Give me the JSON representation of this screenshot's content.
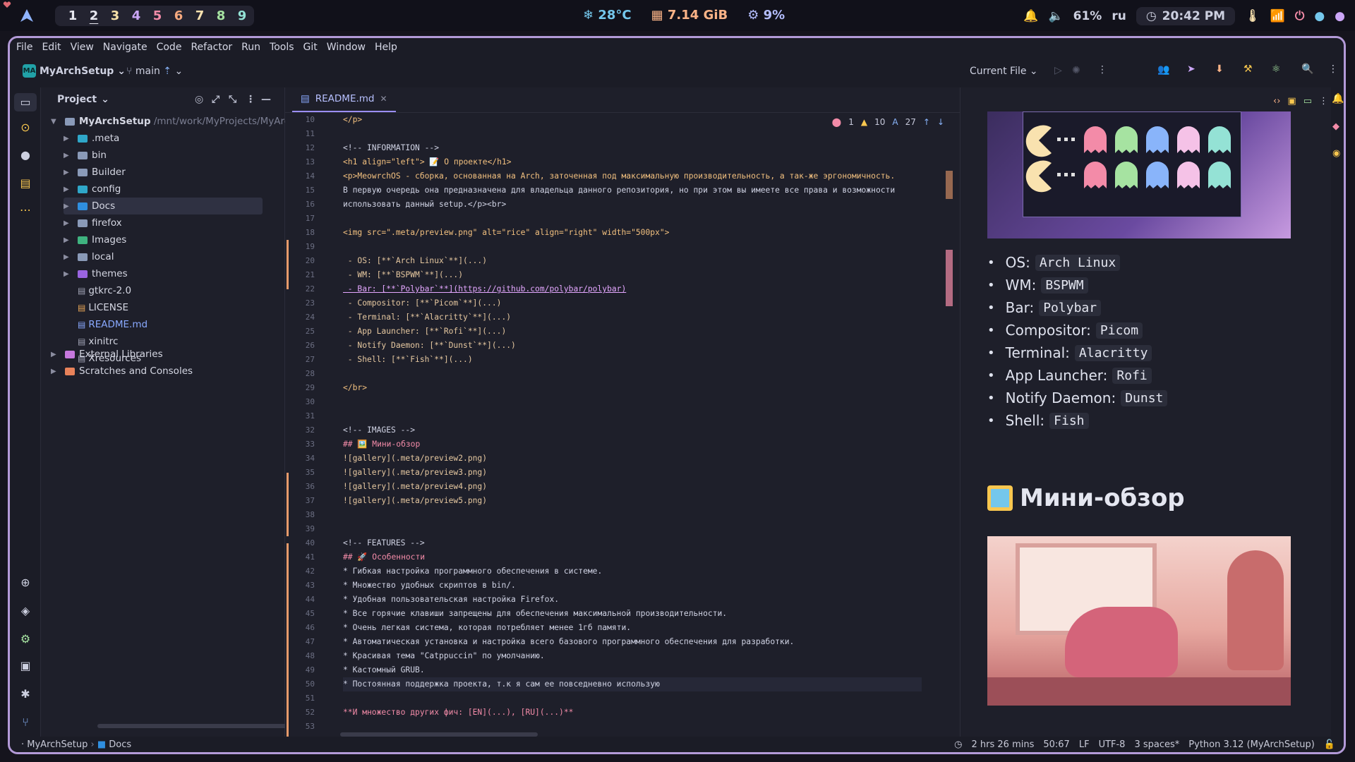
{
  "desktop": {
    "workspaces": [
      "1",
      "2",
      "3",
      "4",
      "5",
      "6",
      "7",
      "8",
      "9"
    ],
    "active_workspace": "2",
    "temperature": "28°C",
    "memory": "7.14 GiB",
    "cpu": "9%",
    "volume": "61%",
    "keyboard_layout": "ru",
    "clock": "20:42 PM"
  },
  "menu": [
    "File",
    "Edit",
    "View",
    "Navigate",
    "Code",
    "Refactor",
    "Run",
    "Tools",
    "Git",
    "Window",
    "Help"
  ],
  "toolbar": {
    "project_badge": "MA",
    "project_name": "MyArchSetup",
    "branch": "main",
    "run_config": "Current File"
  },
  "project_panel": {
    "title": "Project",
    "root_name": "MyArchSetup",
    "root_path": "/mnt/work/MyProjects/MyArchSetup",
    "items": [
      {
        "label": ".meta",
        "type": "folder",
        "color": "#2fa7c9"
      },
      {
        "label": "bin",
        "type": "folder",
        "color": "#8a9ab8"
      },
      {
        "label": "Builder",
        "type": "folder",
        "color": "#8a9ab8"
      },
      {
        "label": "config",
        "type": "folder",
        "color": "#2fa7c9"
      },
      {
        "label": "Docs",
        "type": "folder",
        "color": "#2f8fe0"
      },
      {
        "label": "firefox",
        "type": "folder",
        "color": "#8a9ab8"
      },
      {
        "label": "Images",
        "type": "folder",
        "color": "#3fb380"
      },
      {
        "label": "local",
        "type": "folder",
        "color": "#8a9ab8"
      },
      {
        "label": "themes",
        "type": "folder",
        "color": "#9a64e0"
      },
      {
        "label": "gtkrc-2.0",
        "type": "file",
        "color": "#a0a3b5"
      },
      {
        "label": "LICENSE",
        "type": "file",
        "color": "#e8a657"
      },
      {
        "label": "README.md",
        "type": "file",
        "color": "#89a9ff"
      },
      {
        "label": "xinitrc",
        "type": "file",
        "color": "#a0a3b5"
      },
      {
        "label": "Xresources",
        "type": "file",
        "color": "#a0a3b5"
      }
    ],
    "external": "External Libraries",
    "scratches": "Scratches and Consoles"
  },
  "editor": {
    "tab_label": "README.md",
    "errors": "1",
    "warnings": "10",
    "typos": "27",
    "lines": [
      {
        "n": "10",
        "t": "</p>"
      },
      {
        "n": "11",
        "t": ""
      },
      {
        "n": "12",
        "t": "<!-- INFORMATION -->"
      },
      {
        "n": "13",
        "t": "<h1 align=\"left\"> 📝 О проекте</h1>"
      },
      {
        "n": "14",
        "t": "<p>MeowrchOS - сборка, основанная на Arch, заточенная под максимальную производительность, а так-же эргономичность."
      },
      {
        "n": "15",
        "t": "В первую очередь она предназначена для владельца данного репозитория, но при этом вы имеете все права и возможности"
      },
      {
        "n": "16",
        "t": "использовать данный setup.</p><br>"
      },
      {
        "n": "17",
        "t": ""
      },
      {
        "n": "18",
        "t": "<img src=\".meta/preview.png\" alt=\"rice\" align=\"right\" width=\"500px\">"
      },
      {
        "n": "19",
        "t": ""
      },
      {
        "n": "20",
        "t": " - OS: [**`Arch Linux`**](...)"
      },
      {
        "n": "21",
        "t": " - WM: [**`BSPWM`**](...)"
      },
      {
        "n": "22",
        "t": " - Bar: [**`Polybar`**](https://github.com/polybar/polybar)"
      },
      {
        "n": "23",
        "t": " - Compositor: [**`Picom`**](...)"
      },
      {
        "n": "24",
        "t": " - Terminal: [**`Alacritty`**](...)"
      },
      {
        "n": "25",
        "t": " - App Launcher: [**`Rofi`**](...)"
      },
      {
        "n": "26",
        "t": " - Notify Daemon: [**`Dunst`**](...)"
      },
      {
        "n": "27",
        "t": " - Shell: [**`Fish`**](...)"
      },
      {
        "n": "28",
        "t": ""
      },
      {
        "n": "29",
        "t": "</br>"
      },
      {
        "n": "30",
        "t": ""
      },
      {
        "n": "31",
        "t": ""
      },
      {
        "n": "32",
        "t": "<!-- IMAGES -->"
      },
      {
        "n": "33",
        "t": "## 🖼️ Мини-обзор"
      },
      {
        "n": "34",
        "t": "![gallery](.meta/preview2.png)"
      },
      {
        "n": "35",
        "t": "![gallery](.meta/preview3.png)"
      },
      {
        "n": "36",
        "t": "![gallery](.meta/preview4.png)"
      },
      {
        "n": "37",
        "t": "![gallery](.meta/preview5.png)"
      },
      {
        "n": "38",
        "t": ""
      },
      {
        "n": "39",
        "t": ""
      },
      {
        "n": "40",
        "t": "<!-- FEATURES -->"
      },
      {
        "n": "41",
        "t": "## 🚀 Особенности"
      },
      {
        "n": "42",
        "t": "* Гибкая настройка программного обеспечения в системе."
      },
      {
        "n": "43",
        "t": "* Множество удобных скриптов в bin/."
      },
      {
        "n": "44",
        "t": "* Удобная пользовательская настройка Firefox."
      },
      {
        "n": "45",
        "t": "* Все горячие клавиши запрещены для обеспечения максимальной производительности."
      },
      {
        "n": "46",
        "t": "* Очень легкая система, которая потребляет менее 1гб памяти."
      },
      {
        "n": "47",
        "t": "* Автоматическая установка и настройка всего базового программного обеспечения для разработки."
      },
      {
        "n": "48",
        "t": "* Красивая тема \"Catppuccin\" по умолчанию."
      },
      {
        "n": "49",
        "t": "* Кастомный GRUB."
      },
      {
        "n": "50",
        "t": "* Постоянная поддержка проекта, т.к я сам ее повседневно использую"
      },
      {
        "n": "51",
        "t": ""
      },
      {
        "n": "52",
        "t": "**И множество других фич: [EN](...), [RU](...)**"
      },
      {
        "n": "53",
        "t": ""
      }
    ]
  },
  "preview": {
    "specs": [
      {
        "key": "OS:",
        "value": "Arch Linux"
      },
      {
        "key": "WM:",
        "value": "BSPWM"
      },
      {
        "key": "Bar:",
        "value": "Polybar"
      },
      {
        "key": "Compositor:",
        "value": "Picom"
      },
      {
        "key": "Terminal:",
        "value": "Alacritty"
      },
      {
        "key": "App Launcher:",
        "value": "Rofi"
      },
      {
        "key": "Notify Daemon:",
        "value": "Dunst"
      },
      {
        "key": "Shell:",
        "value": "Fish"
      }
    ],
    "heading": "Мини-обзор"
  },
  "status": {
    "breadcrumb_project": "MyArchSetup",
    "breadcrumb_folder": "Docs",
    "time_tracked": "2 hrs 26 mins",
    "position": "50:67",
    "line_sep": "LF",
    "encoding": "UTF-8",
    "indent": "3 spaces*",
    "interpreter": "Python 3.12 (MyArchSetup)"
  },
  "colors": {
    "accent": "#b39ad8",
    "background": "#1e1f2a",
    "modified": "#e79a6b"
  }
}
